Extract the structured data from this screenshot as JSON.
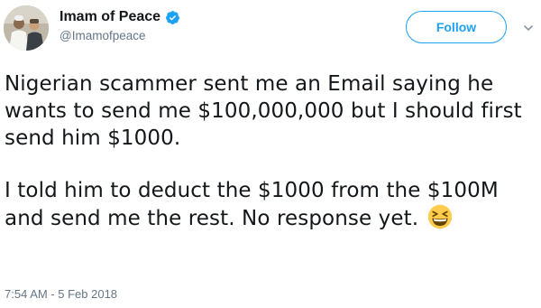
{
  "tweet": {
    "author": {
      "display_name": "Imam of Peace",
      "handle": "@Imamofpeace",
      "verified_icon": "verified-badge-icon"
    },
    "follow_label": "Follow",
    "menu_icon": "chevron-down-icon",
    "body": {
      "paragraph_1": "Nigerian scammer sent me an Email saying he wants to send me $100,000,000 but I should first send him $1000.",
      "paragraph_2": "I told him to deduct the $1000 from the $100M and send me the rest. No response yet.",
      "emoji": "grinning-squinting-face-emoji"
    },
    "timestamp": "7:54 AM - 5 Feb 2018"
  },
  "colors": {
    "brand_blue": "#1da1f2",
    "text_primary": "#14171a",
    "text_secondary": "#657786"
  }
}
